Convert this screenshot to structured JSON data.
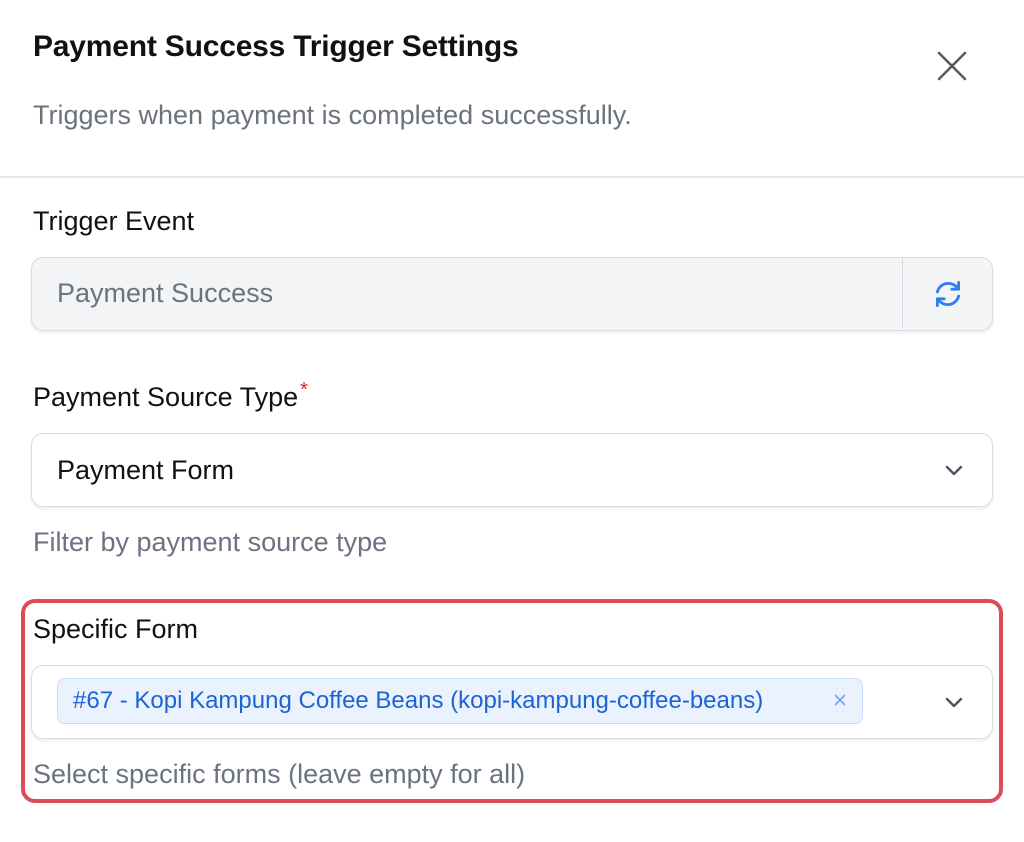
{
  "header": {
    "title": "Payment Success Trigger Settings",
    "subtitle": "Triggers when payment is completed successfully."
  },
  "trigger_event": {
    "label": "Trigger Event",
    "value": "Payment Success"
  },
  "payment_source_type": {
    "label": "Payment Source Type",
    "required_mark": "*",
    "selected": "Payment Form",
    "helper": "Filter by payment source type"
  },
  "specific_form": {
    "label": "Specific Form",
    "selected_tags": [
      "#67 - Kopi Kampung Coffee Beans (kopi-kampung-coffee-beans)"
    ],
    "helper": "Select specific forms (leave empty for all)"
  },
  "colors": {
    "highlight_border": "#dc4c58",
    "tag_text": "#1d63d8",
    "tag_background": "#eaf2fe",
    "required": "#dc2626",
    "refresh_icon": "#2f80ed"
  },
  "icons": {
    "close": "close-icon",
    "refresh": "refresh-icon",
    "chevron": "chevron-down-icon",
    "tag_remove": "tag-remove-icon"
  }
}
